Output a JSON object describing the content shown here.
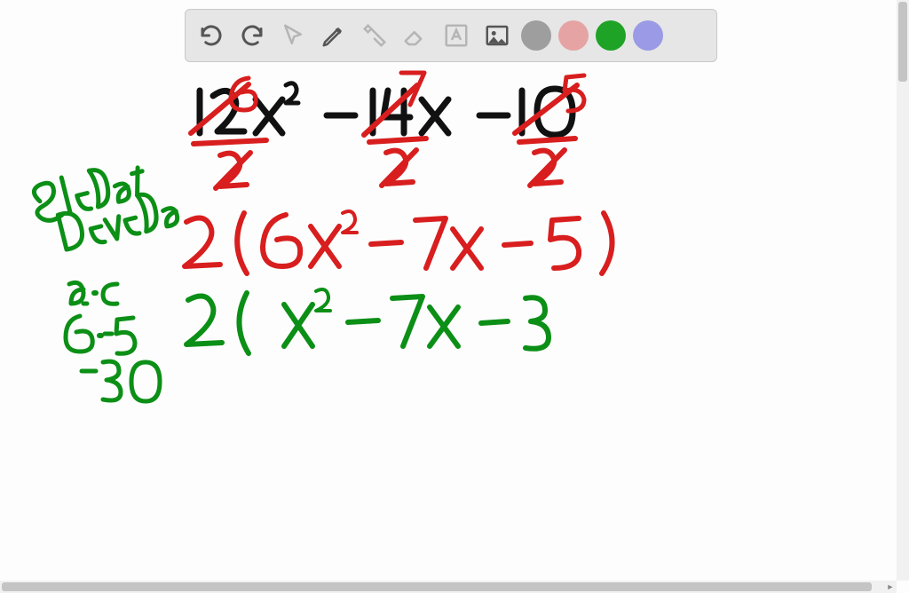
{
  "toolbar": {
    "tools": [
      {
        "name": "undo-icon"
      },
      {
        "name": "redo-icon"
      },
      {
        "name": "pointer-icon"
      },
      {
        "name": "pencil-icon"
      },
      {
        "name": "tools-icon"
      },
      {
        "name": "eraser-icon"
      },
      {
        "name": "text-icon"
      },
      {
        "name": "image-icon"
      }
    ],
    "colors": {
      "gray": "#9e9e9e",
      "pink": "#e6a3a3",
      "green": "#1fa326",
      "purple": "#9a9ae6"
    }
  },
  "handwriting": {
    "black": {
      "expression": "12x² - 14x - 10"
    },
    "red": {
      "annotations_top": [
        "6",
        "7",
        "5"
      ],
      "divisors": [
        "2",
        "2",
        "2"
      ],
      "factored_line": "2 ( 6x² - 7x - 5 )"
    },
    "green": {
      "method_label_line1": "Slide &",
      "method_label_line2": "Divide",
      "ac_label": "a·c",
      "ac_calc": "6·-5",
      "ac_result": "-30",
      "second_line": "2 ( x² - 7x - 3"
    }
  }
}
